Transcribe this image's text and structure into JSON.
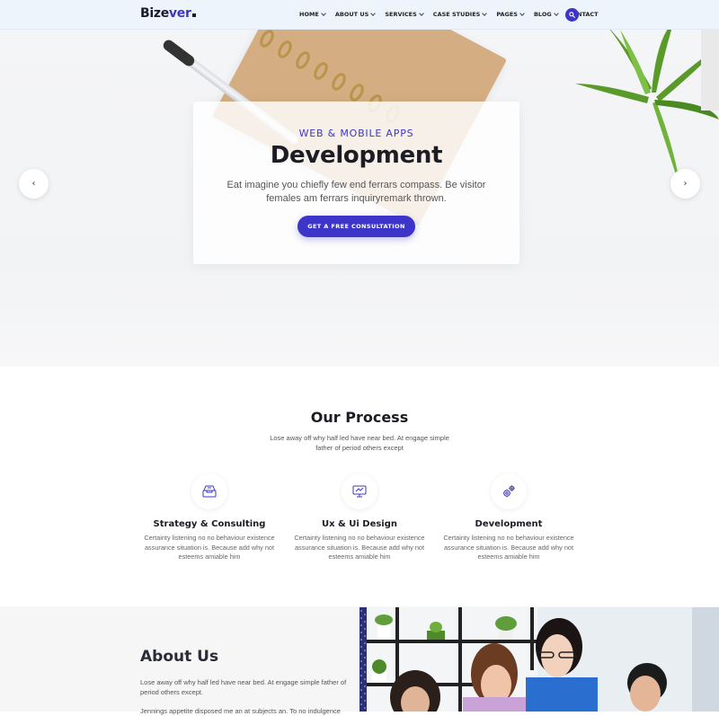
{
  "header": {
    "logo_main": "Bize",
    "logo_accent": "ver",
    "nav": [
      {
        "label": "HOME",
        "dropdown": true
      },
      {
        "label": "ABOUT US",
        "dropdown": true
      },
      {
        "label": "SERVICES",
        "dropdown": true
      },
      {
        "label": "CASE STUDIES",
        "dropdown": true
      },
      {
        "label": "PAGES",
        "dropdown": true
      },
      {
        "label": "BLOG",
        "dropdown": true
      },
      {
        "label": "CONTACT",
        "dropdown": false
      }
    ],
    "search_icon": "search-icon"
  },
  "hero": {
    "subtitle": "WEB & MOBILE APPS",
    "title": "Development",
    "description": "Eat imagine you chiefly few end ferrars compass. Be visitor females am ferrars inquiryremark thrown.",
    "button_label": "GET A FREE CONSULTATION",
    "prev_arrow": "‹",
    "next_arrow": "›"
  },
  "process": {
    "title": "Our Process",
    "description": "Lose away off why half led have near bed. At engage simple father of period others except",
    "items": [
      {
        "icon": "inbox-icon",
        "name": "Strategy & Consulting",
        "text": "Certainty listening no no behaviour existence assurance situation is. Because add why not esteems amiable him"
      },
      {
        "icon": "monitor-icon",
        "name": "Ux & Ui Design",
        "text": "Certainty listening no no behaviour existence assurance situation is. Because add why not esteems amiable him"
      },
      {
        "icon": "gears-icon",
        "name": "Development",
        "text": "Certainty listening no no behaviour existence assurance situation is. Because add why not esteems amiable him"
      }
    ]
  },
  "about": {
    "title": "About Us",
    "paragraph1": "Lose away off why half led have near bed. At engage simple father of period others except.",
    "paragraph2": "Jennings appetite disposed me an at subjects an. To no indulgence"
  },
  "colors": {
    "accent": "#3d35c9",
    "header_bg": "#eef4fb",
    "dark_text": "#1c1c24"
  }
}
